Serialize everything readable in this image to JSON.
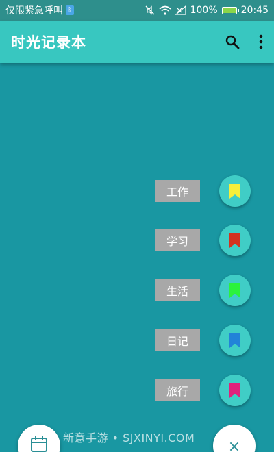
{
  "status_bar": {
    "carrier": "仅限紧急呼叫",
    "bt": "ᛒ",
    "battery": "100%",
    "time": "20:45"
  },
  "app_bar": {
    "title": "时光记录本",
    "icons": [
      "search-icon",
      "more-vert-icon"
    ]
  },
  "tags": [
    {
      "label": "工作",
      "color": "#f6ef3a"
    },
    {
      "label": "学习",
      "color": "#d3321f"
    },
    {
      "label": "生活",
      "color": "#2bf33c"
    },
    {
      "label": "日记",
      "color": "#2283d8"
    },
    {
      "label": "旅行",
      "color": "#e0217c"
    }
  ],
  "fab_right": {
    "glyph": "×"
  },
  "watermark": "新意手游 • SJXINYI.COM",
  "colors": {
    "background": "#1997a2",
    "app_bar": "#38c7c0",
    "status_bar": "#2e8f8c",
    "fab": "#40cdc6"
  }
}
